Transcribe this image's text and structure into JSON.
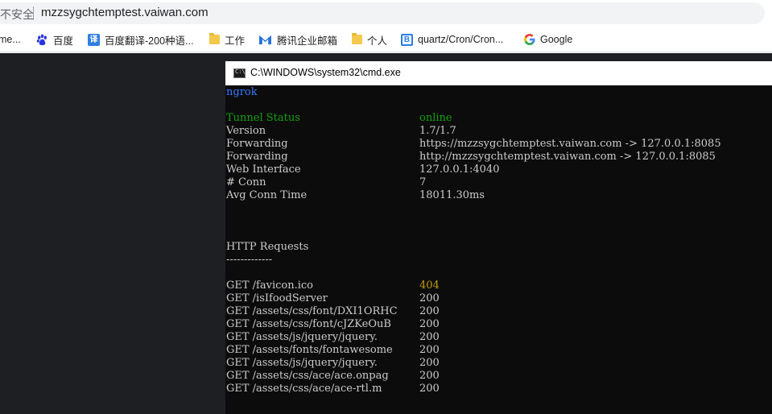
{
  "browser": {
    "insecure_label": "不安全",
    "url": "mzzsygchtemptest.vaiwan.com",
    "bookmarks": [
      {
        "label": "me...",
        "icon": "partial-bookmark"
      },
      {
        "label": "百度",
        "icon": "baidu-paw-icon"
      },
      {
        "label": "百度翻译-200种语...",
        "icon": "translate-icon"
      },
      {
        "label": "工作",
        "icon": "folder-icon"
      },
      {
        "label": "腾讯企业邮箱",
        "icon": "tencent-mail-icon"
      },
      {
        "label": "个人",
        "icon": "folder-icon"
      },
      {
        "label": "quartz/Cron/Cron...",
        "icon": "bookmark-b-icon"
      },
      {
        "label": "Google",
        "icon": "google-icon"
      }
    ]
  },
  "cmd": {
    "title": "C:\\WINDOWS\\system32\\cmd.exe",
    "app_name": "ngrok",
    "status": [
      {
        "key": "Tunnel Status",
        "value": "online"
      },
      {
        "key": "Version",
        "value": "1.7/1.7"
      },
      {
        "key": "Forwarding",
        "value": "https://mzzsygchtemptest.vaiwan.com -> 127.0.0.1:8085"
      },
      {
        "key": "Forwarding",
        "value": "http://mzzsygchtemptest.vaiwan.com -> 127.0.0.1:8085"
      },
      {
        "key": "Web Interface",
        "value": "127.0.0.1:4040"
      },
      {
        "key": "# Conn",
        "value": "7"
      },
      {
        "key": "Avg Conn Time",
        "value": "18011.30ms"
      }
    ],
    "requests_heading": "HTTP Requests",
    "requests_rule": "-------------",
    "requests": [
      {
        "request": "GET /favicon.ico",
        "code": "404"
      },
      {
        "request": "GET /isIfoodServer",
        "code": "200"
      },
      {
        "request": "GET /assets/css/font/DXI1ORHC",
        "code": "200"
      },
      {
        "request": "GET /assets/css/font/cJZKeOuB",
        "code": "200"
      },
      {
        "request": "GET /assets/js/jquery/jquery.",
        "code": "200"
      },
      {
        "request": "GET /assets/fonts/fontawesome",
        "code": "200"
      },
      {
        "request": "GET /assets/js/jquery/jquery.",
        "code": "200"
      },
      {
        "request": "GET /assets/css/ace/ace.onpag",
        "code": "200"
      },
      {
        "request": "GET /assets/css/ace/ace-rtl.m",
        "code": "200"
      }
    ],
    "colors": {
      "app_name": "#3b78ff",
      "online": "#13a10e",
      "not_found": "#c19c00",
      "default_text": "#cccccc",
      "background": "#0c0c0c"
    }
  }
}
